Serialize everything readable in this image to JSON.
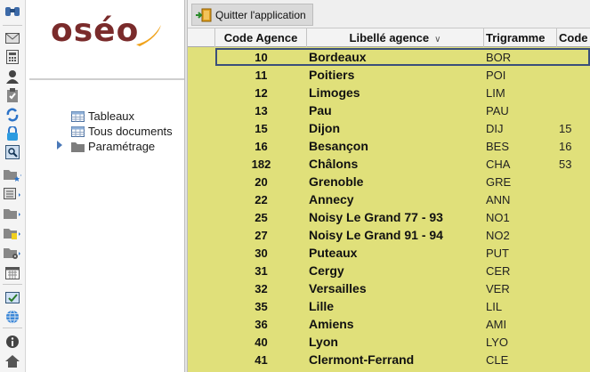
{
  "toolbar": {
    "quit_label": "Quitter l'application"
  },
  "logo": {
    "text": "oséo"
  },
  "tree": [
    {
      "label": "Tableaux",
      "icon": "table-icon"
    },
    {
      "label": "Tous documents",
      "icon": "table-icon"
    },
    {
      "label": "Paramétrage",
      "icon": "folder-icon"
    }
  ],
  "grid": {
    "columns": [
      "Code Agence",
      "Libellé agence",
      "Trigramme",
      "Code"
    ],
    "rows": [
      {
        "code": "10",
        "label": "Bordeaux",
        "tri": "BOR",
        "code2": ""
      },
      {
        "code": "11",
        "label": "Poitiers",
        "tri": "POI",
        "code2": ""
      },
      {
        "code": "12",
        "label": "Limoges",
        "tri": "LIM",
        "code2": ""
      },
      {
        "code": "13",
        "label": "Pau",
        "tri": "PAU",
        "code2": ""
      },
      {
        "code": "15",
        "label": "Dijon",
        "tri": "DIJ",
        "code2": "15"
      },
      {
        "code": "16",
        "label": "Besançon",
        "tri": "BES",
        "code2": "16"
      },
      {
        "code": "182",
        "label": "Châlons",
        "tri": "CHA",
        "code2": "53"
      },
      {
        "code": "20",
        "label": "Grenoble",
        "tri": "GRE",
        "code2": ""
      },
      {
        "code": "22",
        "label": "Annecy",
        "tri": "ANN",
        "code2": ""
      },
      {
        "code": "25",
        "label": "Noisy Le Grand 77 - 93",
        "tri": "NO1",
        "code2": ""
      },
      {
        "code": "27",
        "label": "Noisy Le Grand 91 - 94",
        "tri": "NO2",
        "code2": ""
      },
      {
        "code": "30",
        "label": "Puteaux",
        "tri": "PUT",
        "code2": ""
      },
      {
        "code": "31",
        "label": "Cergy",
        "tri": "CER",
        "code2": ""
      },
      {
        "code": "32",
        "label": "Versailles",
        "tri": "VER",
        "code2": ""
      },
      {
        "code": "35",
        "label": "Lille",
        "tri": "LIL",
        "code2": ""
      },
      {
        "code": "36",
        "label": "Amiens",
        "tri": "AMI",
        "code2": ""
      },
      {
        "code": "40",
        "label": "Lyon",
        "tri": "LYO",
        "code2": ""
      },
      {
        "code": "41",
        "label": "Clermont-Ferrand",
        "tri": "CLE",
        "code2": ""
      }
    ]
  },
  "colors": {
    "grid_bg": "#e0e07a",
    "logo": "#7a2b2b",
    "swoosh": "#f0a31c",
    "selection": "#3a4f7a"
  }
}
